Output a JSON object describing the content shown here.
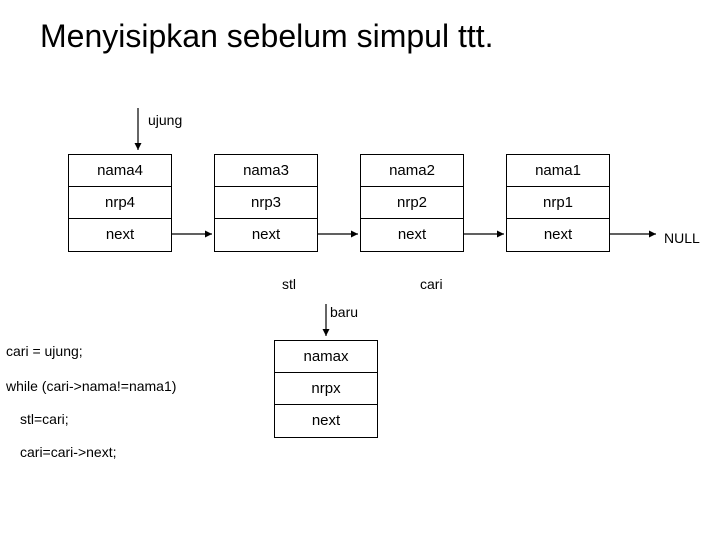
{
  "title": "Menyisipkan sebelum simpul ttt.",
  "labels": {
    "ujung": "ujung",
    "stl": "stl",
    "cari": "cari",
    "baru": "baru",
    "null": "NULL"
  },
  "nodes": [
    {
      "nama": "nama4",
      "nrp": "nrp4",
      "next": "next"
    },
    {
      "nama": "nama3",
      "nrp": "nrp3",
      "next": "next"
    },
    {
      "nama": "nama2",
      "nrp": "nrp2",
      "next": "next"
    },
    {
      "nama": "nama1",
      "nrp": "nrp1",
      "next": "next"
    }
  ],
  "baru_node": {
    "nama": "namax",
    "nrp": "nrpx",
    "next": "next"
  },
  "code": {
    "l1": "cari = ujung;",
    "l2": "while (cari->nama!=nama1)",
    "l3": "stl=cari;",
    "l4": "cari=cari->next;"
  }
}
